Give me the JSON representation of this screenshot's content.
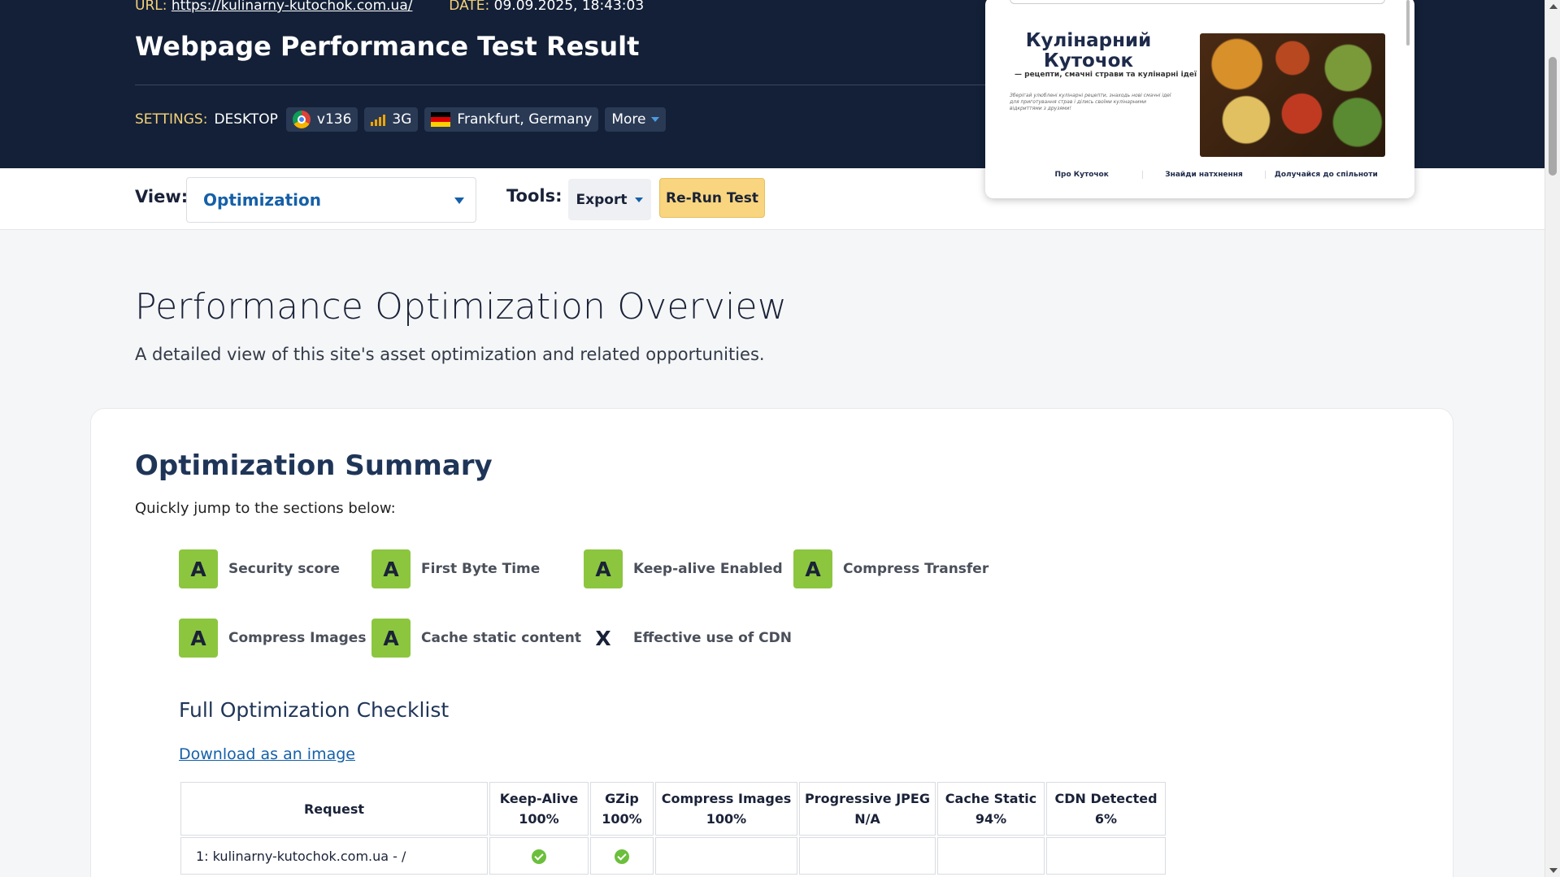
{
  "header": {
    "url_label": "URL:",
    "url": "https://kulinarny-kutochok.com.ua/",
    "date_label": "DATE:",
    "date": "09.09.2025, 18:43:03",
    "title": "Webpage Performance Test Result",
    "settings_label": "SETTINGS:",
    "device": "DESKTOP",
    "browser_version": "v136",
    "connection": "3G",
    "location": "Frankfurt, Germany",
    "more_label": "More"
  },
  "toolbar": {
    "view_label": "View:",
    "view_value": "Optimization",
    "tools_label": "Tools:",
    "export_label": "Export",
    "rerun_label": "Re-Run Test"
  },
  "thumbnail": {
    "heading": "Кулінарний Куточок",
    "subtitle": "— рецепти, смачні страви та кулінарні ідеї",
    "description": "Зберігай улюблені кулінарні рецепти, знаходь нові смачні ідеї для приготування страв і ділись своїми кулінарними відкриттями з друзями!",
    "tabs": [
      "Про Куточок",
      "Знайди натхнення",
      "Долучайся до спільноти"
    ]
  },
  "main": {
    "heading": "Performance Optimization Overview",
    "lead": "A detailed view of this site's asset optimization and related opportunities."
  },
  "summary": {
    "heading": "Optimization Summary",
    "jump_text": "Quickly jump to the sections below:",
    "grades": [
      {
        "grade": "A",
        "label": "Security score"
      },
      {
        "grade": "A",
        "label": "First Byte Time"
      },
      {
        "grade": "A",
        "label": "Keep-alive Enabled"
      },
      {
        "grade": "A",
        "label": "Compress Transfer"
      },
      {
        "grade": "A",
        "label": "Compress Images"
      },
      {
        "grade": "A",
        "label": "Cache static content"
      },
      {
        "grade": "X",
        "label": "Effective use of CDN"
      }
    ]
  },
  "checklist": {
    "heading": "Full Optimization Checklist",
    "download_label": "Download as an image",
    "columns": [
      {
        "name": "Request",
        "value": ""
      },
      {
        "name": "Keep-Alive",
        "value": "100%"
      },
      {
        "name": "GZip",
        "value": "100%"
      },
      {
        "name": "Compress Images",
        "value": "100%"
      },
      {
        "name": "Progressive JPEG",
        "value": "N/A"
      },
      {
        "name": "Cache Static",
        "value": "94%"
      },
      {
        "name": "CDN Detected",
        "value": "6%"
      }
    ],
    "rows": [
      {
        "request": "1: kulinarny-kutochok.com.ua - /",
        "keep_alive": "pass",
        "gzip": "pass",
        "compress_images": "",
        "progressive_jpeg": "",
        "cache_static": "",
        "cdn": ""
      }
    ]
  },
  "colors": {
    "header_bg": "#132037",
    "accent_yellow": "#f8d57e",
    "grade_green": "#8cc63f",
    "link_blue": "#1560a8"
  }
}
